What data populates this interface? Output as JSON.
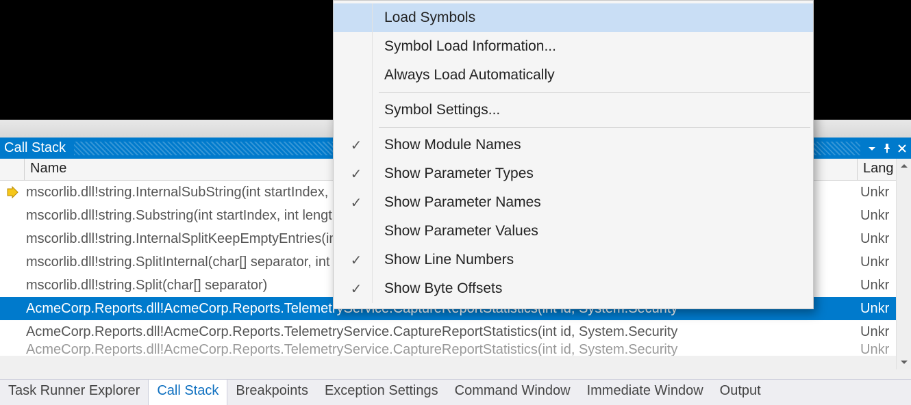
{
  "panel": {
    "title": "Call Stack"
  },
  "columns": {
    "name": "Name",
    "lang": "Lang"
  },
  "rows": [
    {
      "icon": "current",
      "name": "mscorlib.dll!string.InternalSubString(int startIndex, int length)",
      "lang": "Unkr"
    },
    {
      "icon": "",
      "name": "mscorlib.dll!string.Substring(int startIndex, int length)",
      "lang": "Unkr"
    },
    {
      "icon": "",
      "name": "mscorlib.dll!string.InternalSplitKeepEmptyEntries(int[] sepList, int[] lengthList, int numReplaces, int count)",
      "lang": "Unkr"
    },
    {
      "icon": "",
      "name": "mscorlib.dll!string.SplitInternal(char[] separator, int count, System.StringSplitOptions options)",
      "lang": "Unkr"
    },
    {
      "icon": "",
      "name": "mscorlib.dll!string.Split(char[] separator)",
      "lang": "Unkr"
    },
    {
      "icon": "",
      "name": "AcmeCorp.Reports.dll!AcmeCorp.Reports.TelemetryService.CaptureReportStatistics(int id, System.Security",
      "lang": "Unkr",
      "selected": true
    },
    {
      "icon": "",
      "name": "AcmeCorp.Reports.dll!AcmeCorp.Reports.TelemetryService.CaptureReportStatistics(int id, System.Security",
      "lang": "Unkr"
    }
  ],
  "partial_row": {
    "name": "AcmeCorp.Reports.dll!AcmeCorp.Reports.TelemetryService.CaptureReportStatistics(int id, System.Security",
    "lang": "Unkr"
  },
  "tabs": [
    {
      "label": "Task Runner Explorer",
      "active": false
    },
    {
      "label": "Call Stack",
      "active": true
    },
    {
      "label": "Breakpoints",
      "active": false
    },
    {
      "label": "Exception Settings",
      "active": false
    },
    {
      "label": "Command Window",
      "active": false
    },
    {
      "label": "Immediate Window",
      "active": false
    },
    {
      "label": "Output",
      "active": false
    }
  ],
  "menu": {
    "items": [
      {
        "type": "item",
        "label": "Load Symbols",
        "checked": false,
        "highlight": true
      },
      {
        "type": "item",
        "label": "Symbol Load Information...",
        "checked": false
      },
      {
        "type": "item",
        "label": "Always Load Automatically",
        "checked": false
      },
      {
        "type": "sep"
      },
      {
        "type": "item",
        "label": "Symbol Settings...",
        "checked": false
      },
      {
        "type": "sep"
      },
      {
        "type": "item",
        "label": "Show Module Names",
        "checked": true
      },
      {
        "type": "item",
        "label": "Show Parameter Types",
        "checked": true
      },
      {
        "type": "item",
        "label": "Show Parameter Names",
        "checked": true
      },
      {
        "type": "item",
        "label": "Show Parameter Values",
        "checked": false
      },
      {
        "type": "item",
        "label": "Show Line Numbers",
        "checked": true
      },
      {
        "type": "item",
        "label": "Show Byte Offsets",
        "checked": true
      }
    ]
  }
}
